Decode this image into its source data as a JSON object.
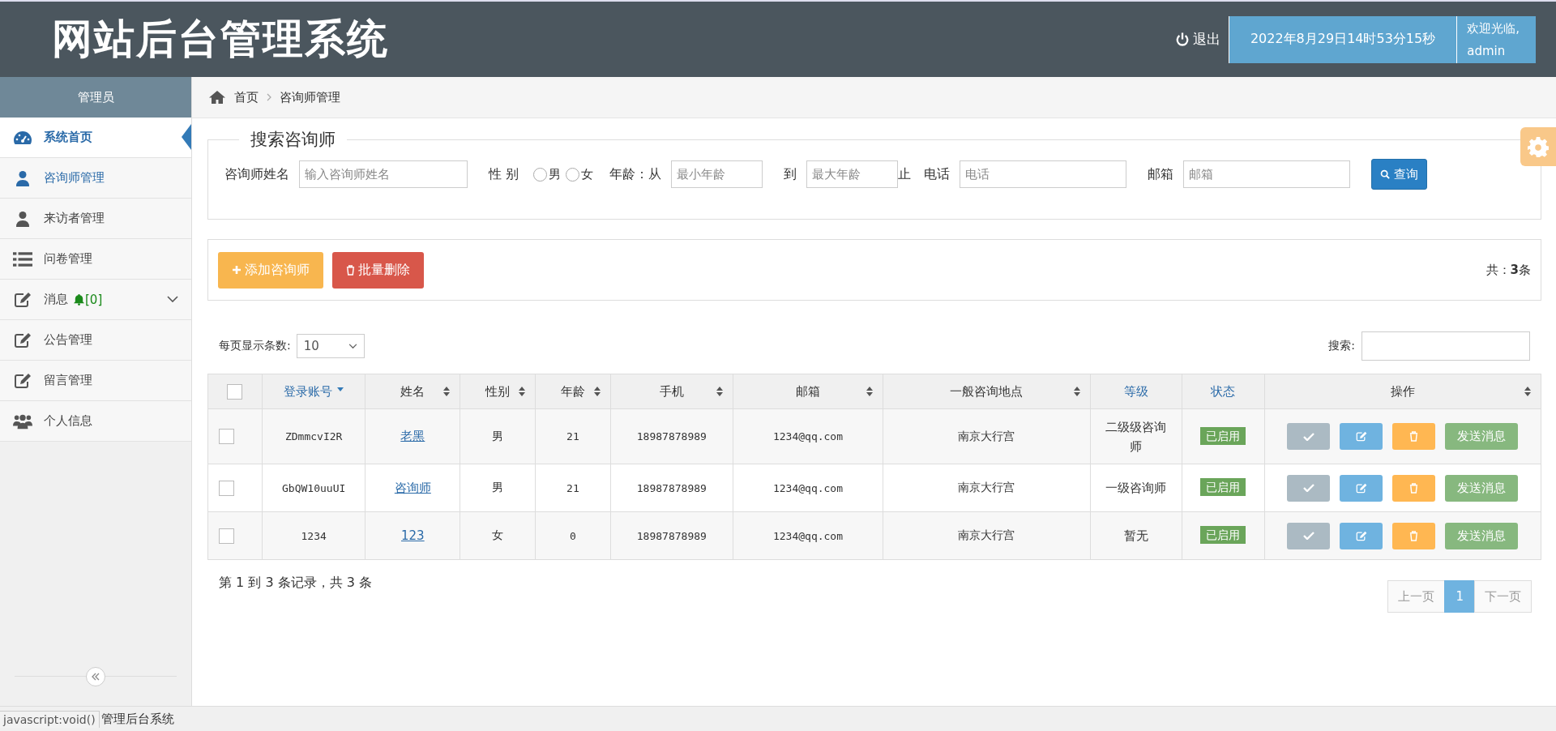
{
  "header": {
    "title": "网站后台管理系统",
    "logout": "退出",
    "datetime": "2022年8月29日14时53分15秒",
    "welcome": [
      "欢迎光临,",
      "admin"
    ]
  },
  "sidebar": {
    "role": "管理员",
    "items": [
      {
        "label": "系统首页",
        "selected": true,
        "highlighted": true
      },
      {
        "label": "咨询师管理",
        "selected": false,
        "highlighted": true
      },
      {
        "label": "来访者管理",
        "selected": false,
        "highlighted": false
      },
      {
        "label": "问卷管理",
        "selected": false,
        "highlighted": false
      },
      {
        "label": "消息",
        "selected": false,
        "highlighted": false,
        "badge": "[0]",
        "expandable": true
      },
      {
        "label": "公告管理",
        "selected": false,
        "highlighted": false
      },
      {
        "label": "留言管理",
        "selected": false,
        "highlighted": false
      },
      {
        "label": "个人信息",
        "selected": false,
        "highlighted": false
      }
    ]
  },
  "breadcrumb": [
    "首页",
    "咨询师管理"
  ],
  "search": {
    "legend": "搜索咨询师",
    "fields": [
      {
        "kind": "text",
        "label": "咨询师姓名",
        "placeholder": "输入咨询师姓名"
      },
      {
        "kind": "radio",
        "label": "性 别",
        "options": [
          {
            "label": "男",
            "selected": false
          },
          {
            "label": "女",
            "selected": false
          }
        ]
      },
      {
        "kind": "range",
        "label": "年龄：从",
        "from_placeholder": "最小年龄",
        "to_label": "到",
        "to_placeholder": "最大年龄",
        "suffix": "止"
      },
      {
        "kind": "text",
        "label": "电话",
        "placeholder": "电话"
      },
      {
        "kind": "text",
        "label": "邮箱",
        "placeholder": "邮箱"
      }
    ],
    "button": "查询"
  },
  "toolbar": {
    "add": "添加咨询师",
    "delete": "批量删除",
    "total_label": "共：",
    "total": "3",
    "total_unit": "条"
  },
  "table": {
    "select_all_checked": false,
    "page_size_label": "每页显示条数:",
    "page_size": "10",
    "search_label": "搜索:",
    "columns": [
      {
        "label": "登录账号",
        "sortable": true,
        "sorted": true,
        "highlight": true
      },
      {
        "label": "姓名",
        "sortable": true,
        "sorted": false,
        "highlight": false
      },
      {
        "label": "性别",
        "sortable": true,
        "sorted": false,
        "highlight": false
      },
      {
        "label": "年龄",
        "sortable": true,
        "sorted": false,
        "highlight": false
      },
      {
        "label": "手机",
        "sortable": true,
        "sorted": false,
        "highlight": false
      },
      {
        "label": "邮箱",
        "sortable": true,
        "sorted": false,
        "highlight": false
      },
      {
        "label": "一般咨询地点",
        "sortable": true,
        "sorted": false,
        "highlight": false
      },
      {
        "label": "等级",
        "sortable": false,
        "sorted": false,
        "highlight": true
      },
      {
        "label": "状态",
        "sortable": false,
        "sorted": false,
        "highlight": true
      },
      {
        "label": "操作",
        "sortable": true,
        "sorted": false,
        "highlight": false
      }
    ],
    "rows": [
      {
        "checked": false,
        "account": "ZDmmcvI2R",
        "name": "老黑",
        "gender": "男",
        "age": "21",
        "phone": "18987878989",
        "email": "1234@qq.com",
        "location": "南京大行宫",
        "level": "二级级咨询师",
        "status": "已启用",
        "send": "发送消息"
      },
      {
        "checked": false,
        "account": "GbQW10uuUI",
        "name": "咨询师",
        "gender": "男",
        "age": "21",
        "phone": "18987878989",
        "email": "1234@qq.com",
        "location": "南京大行宫",
        "level": "一级咨询师",
        "status": "已启用",
        "send": "发送消息"
      },
      {
        "checked": false,
        "account": "1234",
        "name": "123",
        "gender": "女",
        "age": "0",
        "phone": "18987878989",
        "email": "1234@qq.com",
        "location": "南京大行宫",
        "level": "暂无",
        "status": "已启用",
        "send": "发送消息"
      }
    ]
  },
  "pagination": {
    "info": "第 1 到 3 条记录，共 3 条",
    "prev": "上一页",
    "pages": [
      {
        "label": "1",
        "selected": true
      }
    ],
    "next": "下一页"
  },
  "footer": {
    "text": "管理后台系统",
    "status_url": "javascript:void()"
  }
}
